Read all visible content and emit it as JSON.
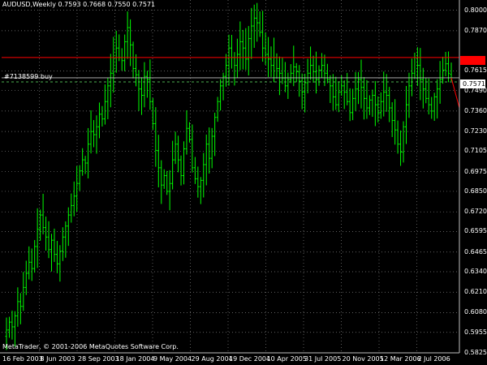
{
  "window": {
    "title": "AUDUSD,Weekly  0.7593 0.7668 0.7550 0.7571",
    "order_label": "#7138599 buy",
    "copyright": "MetaTrader, © 2001-2006 MetaQuotes Software Corp."
  },
  "price_axis": {
    "ticks": [
      "0.8000",
      "0.7870",
      "0.7615",
      "0.7490",
      "0.7360",
      "0.7230",
      "0.7105",
      "0.6975",
      "0.6850",
      "0.6720",
      "0.6595",
      "0.6465",
      "0.6340",
      "0.6210",
      "0.6080",
      "0.5955",
      "0.5825"
    ],
    "current_price": "0.7571",
    "resistance_price": "0.7700"
  },
  "time_axis": {
    "ticks": [
      "16 Feb 2003",
      "8 Jun 2003",
      "28 Sep 2003",
      "18 Jan 2004",
      "9 May 2004",
      "29 Aug 2004",
      "19 Dec 2004",
      "10 Apr 2005",
      "31 Jul 2005",
      "20 Nov 2005",
      "12 Mar 2006",
      "2 Jul 2006"
    ]
  },
  "colors": {
    "background": "#000000",
    "bars": "#00ff00",
    "grid": "#808080",
    "resistance_line": "#ff0000",
    "trend_line": "#ff0000",
    "order_line": "#4caf50",
    "bid_line": "#c0c0c0"
  },
  "chart_data": {
    "type": "ohlc",
    "symbol": "AUDUSD",
    "timeframe": "Weekly",
    "last_bar": {
      "open": 0.7593,
      "high": 0.7668,
      "low": 0.755,
      "close": 0.7571
    },
    "ylim": [
      0.5825,
      0.8065
    ],
    "grid": true,
    "levels": {
      "resistance": 0.77,
      "order_price": 0.7545,
      "bid": 0.7571
    },
    "trend_line": {
      "from_price": 0.7571,
      "to_price": 0.738
    },
    "closes": [
      0.597,
      0.602,
      0.599,
      0.606,
      0.615,
      0.612,
      0.624,
      0.633,
      0.64,
      0.636,
      0.65,
      0.661,
      0.67,
      0.662,
      0.656,
      0.648,
      0.654,
      0.645,
      0.639,
      0.647,
      0.656,
      0.663,
      0.67,
      0.676,
      0.682,
      0.69,
      0.698,
      0.705,
      0.703,
      0.715,
      0.723,
      0.721,
      0.726,
      0.734,
      0.731,
      0.742,
      0.752,
      0.76,
      0.77,
      0.776,
      0.77,
      0.768,
      0.78,
      0.789,
      0.778,
      0.763,
      0.759,
      0.75,
      0.746,
      0.758,
      0.756,
      0.742,
      0.728,
      0.711,
      0.7,
      0.689,
      0.695,
      0.685,
      0.69,
      0.705,
      0.715,
      0.705,
      0.695,
      0.712,
      0.725,
      0.718,
      0.7,
      0.693,
      0.688,
      0.692,
      0.702,
      0.715,
      0.706,
      0.72,
      0.732,
      0.742,
      0.752,
      0.758,
      0.765,
      0.776,
      0.77,
      0.765,
      0.772,
      0.78,
      0.776,
      0.769,
      0.782,
      0.79,
      0.795,
      0.792,
      0.786,
      0.776,
      0.772,
      0.769,
      0.765,
      0.77,
      0.763,
      0.76,
      0.757,
      0.752,
      0.756,
      0.76,
      0.764,
      0.761,
      0.755,
      0.748,
      0.754,
      0.76,
      0.765,
      0.761,
      0.756,
      0.762,
      0.765,
      0.76,
      0.756,
      0.752,
      0.745,
      0.74,
      0.748,
      0.752,
      0.748,
      0.742,
      0.735,
      0.744,
      0.75,
      0.756,
      0.751,
      0.744,
      0.738,
      0.743,
      0.746,
      0.74,
      0.735,
      0.742,
      0.748,
      0.746,
      0.738,
      0.73,
      0.724,
      0.715,
      0.71,
      0.726,
      0.74,
      0.752,
      0.76,
      0.77,
      0.765,
      0.756,
      0.75,
      0.744,
      0.74,
      0.736,
      0.745,
      0.75,
      0.756,
      0.762,
      0.766,
      0.76,
      0.7571
    ]
  }
}
